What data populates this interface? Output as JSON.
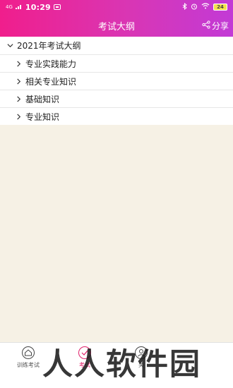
{
  "status_bar": {
    "signal": "4G",
    "time": "10:29",
    "battery": "24"
  },
  "header": {
    "title": "考试大纲",
    "share_label": "分享"
  },
  "tree": {
    "root_label": "2021年考试大纲",
    "children": [
      {
        "label": "专业实践能力"
      },
      {
        "label": "相关专业知识"
      },
      {
        "label": "基础知识"
      },
      {
        "label": "专业知识"
      }
    ]
  },
  "tabbar": {
    "tabs": [
      {
        "label": "训练考试",
        "icon": "home-icon"
      },
      {
        "label": "考试",
        "icon": "exam-icon",
        "active": true
      },
      {
        "label": "关",
        "icon": "user-icon"
      }
    ]
  },
  "watermark": "人人软件园",
  "colors": {
    "brand_start": "#f01e8c",
    "brand_end": "#c23ad6",
    "active_tab": "#e0206a",
    "background": "#f6f1e5"
  }
}
